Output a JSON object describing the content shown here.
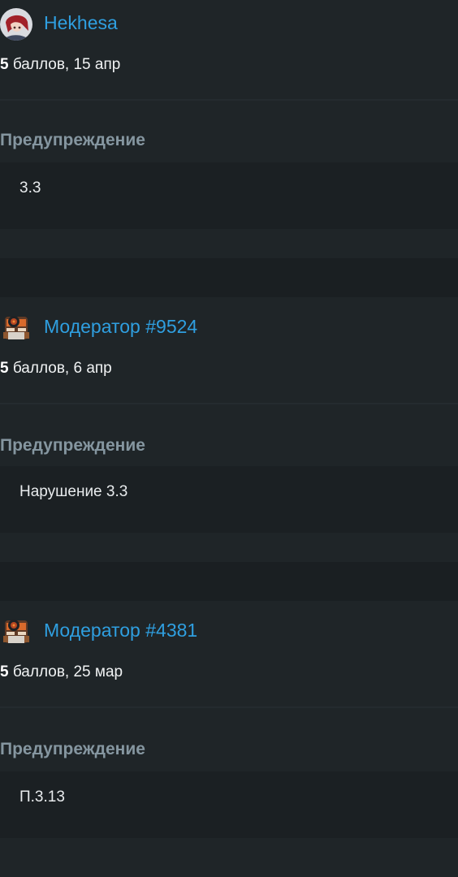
{
  "warnings": [
    {
      "author": "Hekhesa",
      "avatar_icon": "user-avatar-anime",
      "points": "5",
      "points_suffix": "баллов, 15 апр",
      "reason_title": "Предупреждение",
      "reason_text": "3.3"
    },
    {
      "author": "Модератор #9524",
      "avatar_icon": "robot-avatar",
      "points": "5",
      "points_suffix": "баллов, 6 апр",
      "reason_title": "Предупреждение",
      "reason_text": "Нарушение 3.3"
    },
    {
      "author": "Модератор #4381",
      "avatar_icon": "robot-avatar",
      "points": "5",
      "points_suffix": "баллов, 25 мар",
      "reason_title": "Предупреждение",
      "reason_text": "П.3.13"
    }
  ],
  "colors": {
    "background": "#1a1e21",
    "card": "#1f2528",
    "link": "#2f9fe0",
    "muted_heading": "#8596a0"
  }
}
